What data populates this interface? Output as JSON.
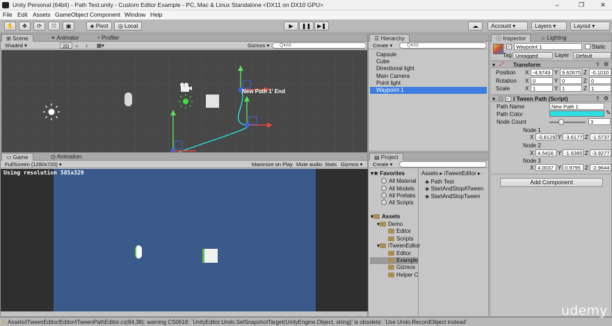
{
  "window": {
    "title": "Unity Personal (64bit) - Path Test.unity - Custom Editor Example - PC, Mac & Linux Standalone <DX11 on DX10 GPU>",
    "minimize": "–",
    "maximize": "❐",
    "close": "✕"
  },
  "menu": [
    "File",
    "Edit",
    "Assets",
    "GameObject",
    "Component",
    "Window",
    "Help"
  ],
  "toolbar": {
    "pivot": "Pivot",
    "local": "Local",
    "account": "Account",
    "layers": "Layers",
    "layout": "Layout"
  },
  "scene": {
    "tabs": [
      "Scene",
      "Animator",
      "Profiler"
    ],
    "shading": "Shaded",
    "mode2d": "2D",
    "gizmos": "Gizmos",
    "search_placeholder": "Q▾All",
    "label": "New Path 1' End"
  },
  "game": {
    "tabs": [
      "Game",
      "Animation"
    ],
    "resolution": "FullScreen (1280x720)",
    "maximize": "Maximize on Play",
    "mute": "Mute audio",
    "stats": "Stats",
    "gizmos": "Gizmos",
    "using_resolution": "Using resolution 585x329"
  },
  "hierarchy": {
    "tab": "Hierarchy",
    "create": "Create",
    "search_placeholder": "Q▾All",
    "items": [
      "Capsule",
      "Cube",
      "Directional light",
      "Main Camera",
      "Point light",
      "Waypoint 1"
    ],
    "selected": "Waypoint 1"
  },
  "project": {
    "tab": "Project",
    "create": "Create",
    "favorites_label": "Favorites",
    "favorites": [
      "All Material",
      "All Models",
      "All Prefabs",
      "All Scripts"
    ],
    "assets_label": "Assets",
    "tree": [
      "Demo",
      "Editor",
      "Scripts",
      "iTweenEditor",
      "Editor",
      "Example",
      "Gizmos",
      "Helper C"
    ],
    "breadcrumb": [
      "Assets",
      "iTweenEditor"
    ],
    "files": [
      "Path Test",
      "StartAndStopATween",
      "StartAndStopTween"
    ]
  },
  "inspector": {
    "tab": "Inspector",
    "tab2": "Lighting",
    "name": "Waypoint 1",
    "static_label": "Static",
    "tag_label": "Tag",
    "tag": "Untagged",
    "layer_label": "Layer",
    "layer": "Default",
    "transform": {
      "title": "Transform",
      "position": {
        "label": "Position",
        "x": "-4.9743",
        "y": "9.62675",
        "z": "-0.1010"
      },
      "rotation": {
        "label": "Rotation",
        "x": "0",
        "y": "0",
        "z": "0"
      },
      "scale": {
        "label": "Scale",
        "x": "1",
        "y": "1",
        "z": "1"
      }
    },
    "itween": {
      "title": "I Tween Path (Script)",
      "path_name_label": "Path Name",
      "path_name": "New Path 1",
      "path_color_label": "Path Color",
      "path_color": "#28e0e0",
      "node_count_label": "Node Count",
      "node_count": "3",
      "nodes": [
        {
          "label": "Node 1",
          "x": "-0.8129",
          "y": "-3.6177",
          "z": "-1.5737"
        },
        {
          "label": "Node 2",
          "x": "4.5416",
          "y": "-1.6385",
          "z": "-3.9277"
        },
        {
          "label": "Node 3",
          "x": "4.0037",
          "y": "0.9795",
          "z": "-2.9644"
        }
      ]
    },
    "add_component": "Add Component"
  },
  "status": "Assets/iTweenEditor/Editor/iTweenPathEditor.cs(84,38): warning CS0618: `UnityEditor.Undo.SetSnapshotTarget(UnityEngine.Object, string)' is obsolete: `Use Undo.RecordObject instead'",
  "watermark": "udemy",
  "colors": {
    "selection": "#3e7de0",
    "path": "#28e0e0",
    "game_bg": "#3a5a8c",
    "scene_bg": "#444444"
  }
}
